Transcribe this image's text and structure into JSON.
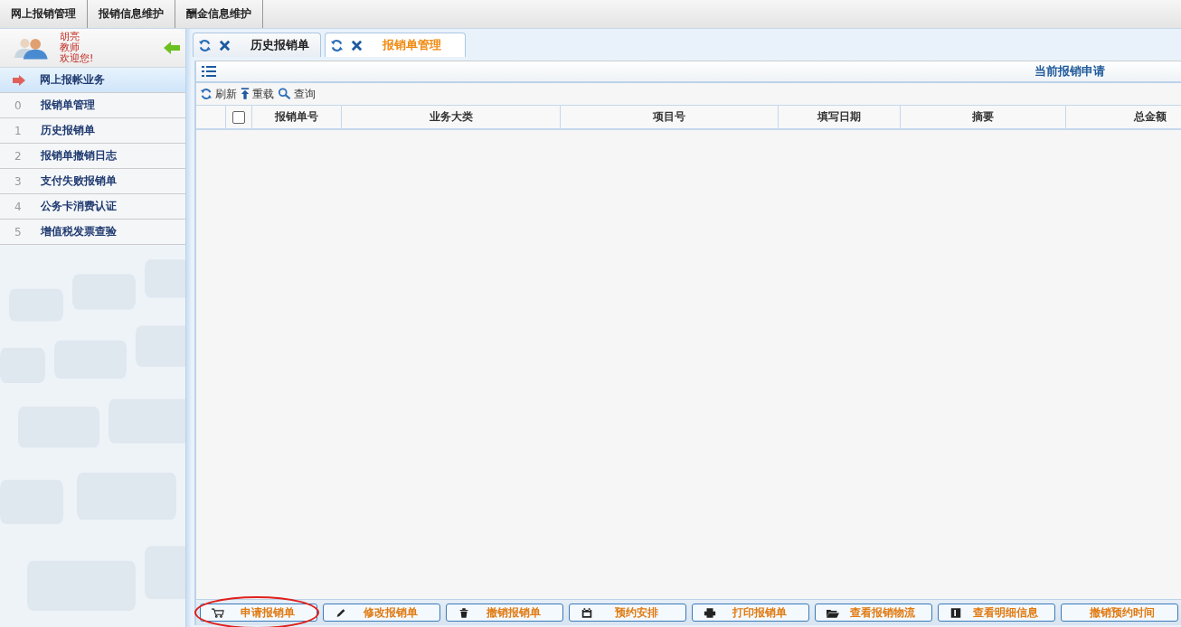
{
  "top_menu": [
    {
      "label": "网上报销管理"
    },
    {
      "label": "报销信息维护"
    },
    {
      "label": "酬金信息维护"
    }
  ],
  "user": {
    "name": "胡亮",
    "role": "教师",
    "greeting": "欢迎您!"
  },
  "sidebar": {
    "section": {
      "label": "网上报帐业务",
      "selected": true
    },
    "items": [
      {
        "number": "0",
        "label": "报销单管理",
        "selected": false
      },
      {
        "number": "1",
        "label": "历史报销单",
        "selected": false
      },
      {
        "number": "2",
        "label": "报销单撤销日志",
        "selected": false
      },
      {
        "number": "3",
        "label": "支付失败报销单",
        "selected": false
      },
      {
        "number": "4",
        "label": "公务卡消费认证",
        "selected": false
      },
      {
        "number": "5",
        "label": "增值税发票查验",
        "selected": false
      }
    ]
  },
  "tabs": [
    {
      "label": "历史报销单",
      "selected": false
    },
    {
      "label": "报销单管理",
      "selected": true
    }
  ],
  "panel": {
    "title": "当前报销申请"
  },
  "toolbar": [
    {
      "label": "刷新"
    },
    {
      "label": "重载"
    },
    {
      "label": "查询"
    }
  ],
  "table": {
    "select_all_checked": false,
    "columns": [
      "报销单号",
      "业务大类",
      "项目号",
      "填写日期",
      "摘要",
      "总金额"
    ]
  },
  "buttons": [
    {
      "label": "申请报销单",
      "circled": true
    },
    {
      "label": "修改报销单",
      "circled": false
    },
    {
      "label": "撤销报销单",
      "circled": false
    },
    {
      "label": "预约安排",
      "circled": false
    },
    {
      "label": "打印报销单",
      "circled": false
    },
    {
      "label": "查看报销物流",
      "circled": false
    },
    {
      "label": "查看明细信息",
      "circled": false
    },
    {
      "label": "撤销预约时间",
      "circled": false
    }
  ]
}
